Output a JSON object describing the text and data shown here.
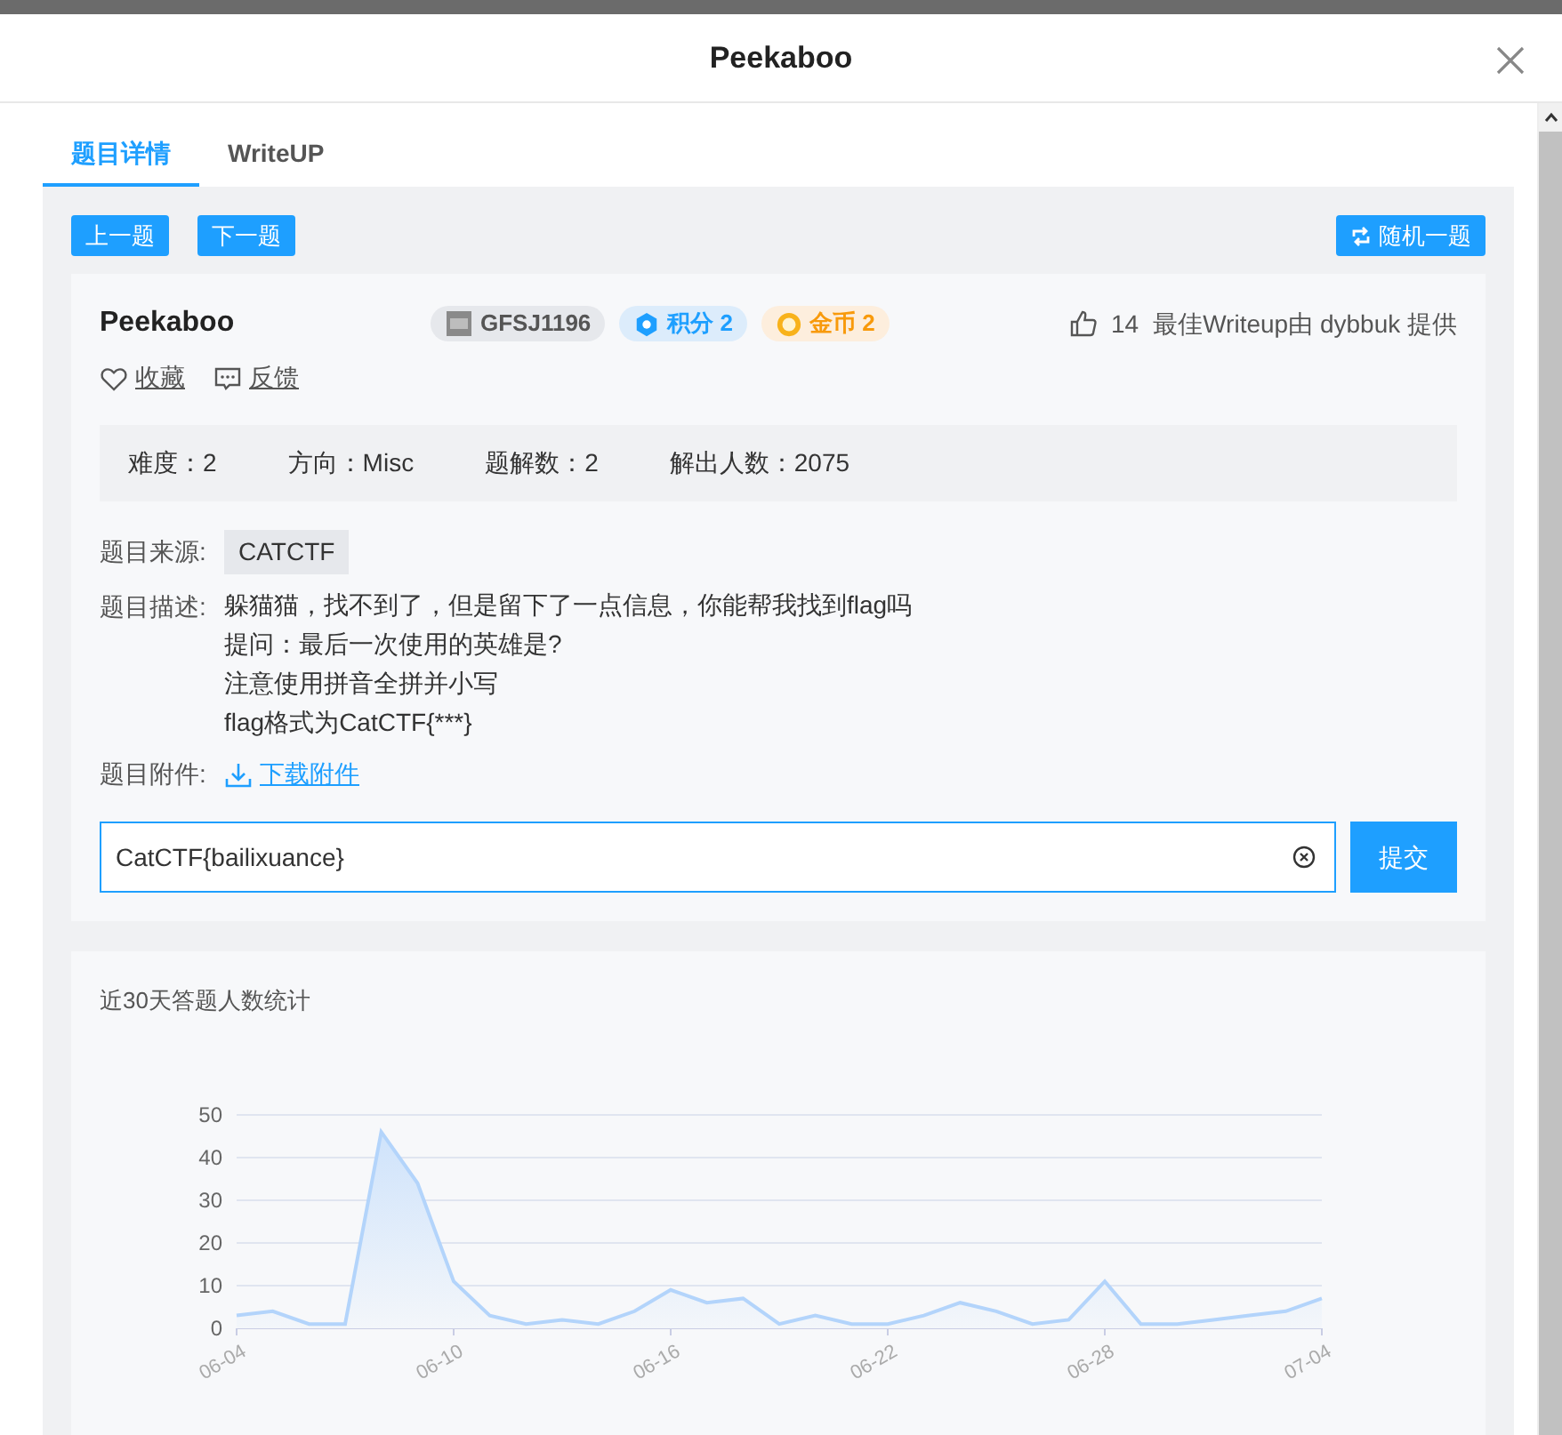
{
  "modal": {
    "title": "Peekaboo"
  },
  "tabs": [
    {
      "label": "题目详情",
      "selected": true
    },
    {
      "label": "WriteUP",
      "selected": false
    }
  ],
  "nav_buttons": [
    {
      "label": "上一题"
    },
    {
      "label": "下一题"
    }
  ],
  "random_button": {
    "label": "随机一题"
  },
  "challenge": {
    "name": "Peekaboo",
    "badges": [
      {
        "kind": "id",
        "text": "GFSJ1196"
      },
      {
        "kind": "score",
        "text": "积分 2"
      },
      {
        "kind": "coin",
        "text": "金币 2"
      }
    ],
    "likes": "14",
    "writeup_credit": "最佳Writeup由 dybbuk 提供",
    "actions": [
      {
        "kind": "favorite",
        "label": "收藏"
      },
      {
        "kind": "feedback",
        "label": "反馈"
      }
    ],
    "stats": [
      "难度：2",
      "方向：Misc",
      "题解数：2",
      "解出人数：2075"
    ],
    "source": {
      "label": "题目来源:",
      "value": "CATCTF"
    },
    "description": {
      "label": "题目描述:",
      "lines": [
        "躲猫猫，找不到了，但是留下了一点信息，你能帮我找到flag吗",
        "提问：最后一次使用的英雄是?",
        "注意使用拼音全拼并小写",
        "flag格式为CatCTF{***}"
      ]
    },
    "attachment": {
      "label": "题目附件:",
      "link": "下载附件"
    },
    "answer": {
      "value": "CatCTF{bailixuance}",
      "submit": "提交"
    }
  },
  "stats_chart": {
    "title": "近30天答题人数统计",
    "chart_data": {
      "type": "area",
      "categories": [
        "06-04",
        null,
        null,
        null,
        null,
        null,
        "06-10",
        null,
        null,
        null,
        null,
        null,
        "06-16",
        null,
        null,
        null,
        null,
        null,
        "06-22",
        null,
        null,
        null,
        null,
        null,
        "06-28",
        null,
        null,
        null,
        null,
        null,
        "07-04"
      ],
      "grid": true,
      "series": [
        {
          "color": "#b3d4fb",
          "values": [
            3,
            4,
            1,
            1,
            46,
            34,
            11,
            3,
            1,
            2,
            1,
            4,
            9,
            6,
            7,
            1,
            3,
            1,
            1,
            3,
            6,
            4,
            1,
            2,
            11,
            1,
            1,
            2,
            3,
            4,
            7
          ]
        }
      ],
      "ylim": [
        0,
        50
      ],
      "yticks": [
        0,
        10,
        20,
        30,
        40,
        50
      ]
    }
  }
}
